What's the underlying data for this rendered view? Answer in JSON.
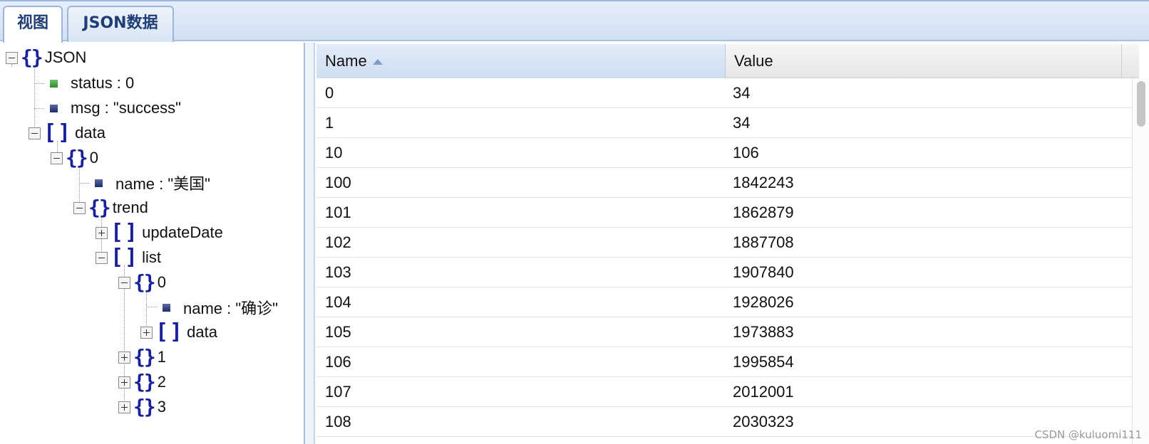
{
  "tabs": [
    {
      "label": "视图",
      "active": true
    },
    {
      "label": "JSON数据",
      "active": false
    }
  ],
  "tree": {
    "root": "JSON",
    "status_label": "status : 0",
    "msg_label": "msg : \"success\"",
    "data_label": "data",
    "item0_label": "0",
    "name_label": "name : \"美国\"",
    "trend_label": "trend",
    "updateDate_label": "updateDate",
    "list_label": "list",
    "list0_label": "0",
    "list0_name_label": "name : \"确诊\"",
    "list0_data_label": "data",
    "list1_label": "1",
    "list2_label": "2",
    "list3_label": "3"
  },
  "grid": {
    "columns": {
      "name": "Name",
      "value": "Value"
    },
    "sort": {
      "column": "Name",
      "direction": "ascending"
    },
    "rows": [
      {
        "name": "0",
        "value": "34"
      },
      {
        "name": "1",
        "value": "34"
      },
      {
        "name": "10",
        "value": "106"
      },
      {
        "name": "100",
        "value": "1842243"
      },
      {
        "name": "101",
        "value": "1862879"
      },
      {
        "name": "102",
        "value": "1887708"
      },
      {
        "name": "103",
        "value": "1907840"
      },
      {
        "name": "104",
        "value": "1928026"
      },
      {
        "name": "105",
        "value": "1973883"
      },
      {
        "name": "106",
        "value": "1995854"
      },
      {
        "name": "107",
        "value": "2012001"
      },
      {
        "name": "108",
        "value": "2030323"
      }
    ]
  },
  "watermark": "CSDN @kuluomi111",
  "colors": {
    "accent": "#1a1f9a",
    "tab_text": "#1f3e76",
    "number_leaf": "#3c9a3c",
    "string_leaf": "#2a3572"
  }
}
